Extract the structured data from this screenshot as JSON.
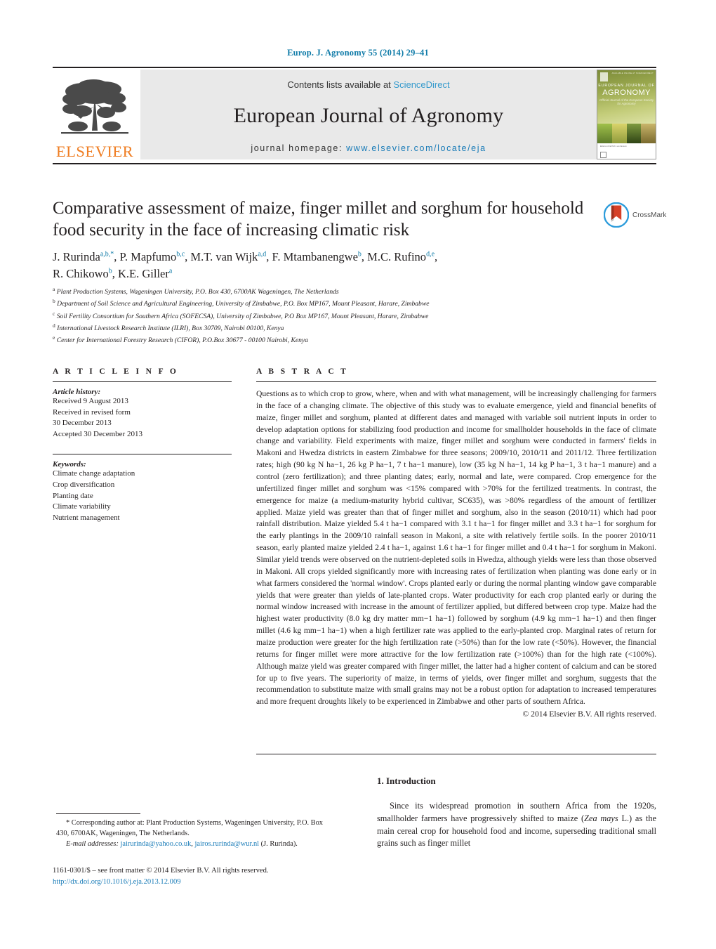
{
  "running_head": "Europ. J. Agronomy 55 (2014) 29–41",
  "masthead": {
    "contents_prefix": "Contents lists available at ",
    "sciencedirect": "ScienceDirect",
    "journal_title": "European Journal of Agronomy",
    "homepage_prefix": "journal homepage: ",
    "homepage_url": "www.elsevier.com/locate/eja",
    "publisher_logo_text": "ELSEVIER",
    "cover": {
      "top_note": "AVAILABLE ONLINE AT SCIENCEDIRECT",
      "line1": "EUROPEAN JOURNAL OF",
      "line2": "AGRONOMY",
      "line3": "Official Journal of the European Society for Agronomy",
      "bottom_note": "Editor-in-Chief\nM.K. van Ittersum"
    },
    "accent_link_color": "#3399cc",
    "url_color": "#1a7cb8",
    "elsevier_orange": "#ef7d22"
  },
  "article": {
    "title": "Comparative assessment of maize, finger millet and sorghum for household food security in the face of increasing climatic risk",
    "crossmark_label": "CrossMark",
    "authors_line1": "J. Rurinda",
    "authors": [
      {
        "name": "J. Rurinda",
        "marks": "a,b,*"
      },
      {
        "name": "P. Mapfumo",
        "marks": "b,c"
      },
      {
        "name": "M.T. van Wijk",
        "marks": "a,d"
      },
      {
        "name": "F. Mtambanengwe",
        "marks": "b"
      },
      {
        "name": "M.C. Rufino",
        "marks": "d,e"
      },
      {
        "name": "R. Chikowo",
        "marks": "b"
      },
      {
        "name": "K.E. Giller",
        "marks": "a"
      }
    ],
    "affiliations": [
      {
        "mark": "a",
        "text": "Plant Production Systems, Wageningen University, P.O. Box 430, 6700AK Wageningen, The Netherlands"
      },
      {
        "mark": "b",
        "text": "Department of Soil Science and Agricultural Engineering, University of Zimbabwe, P.O. Box MP167, Mount Pleasant, Harare, Zimbabwe"
      },
      {
        "mark": "c",
        "text": "Soil Fertility Consortium for Southern Africa (SOFECSA), University of Zimbabwe, P.O Box MP167, Mount Pleasant, Harare, Zimbabwe"
      },
      {
        "mark": "d",
        "text": "International Livestock Research Institute (ILRI), Box 30709, Nairobi 00100, Kenya"
      },
      {
        "mark": "e",
        "text": "Center for International Forestry Research (CIFOR), P.O.Box 30677 - 00100 Nairobi, Kenya"
      }
    ]
  },
  "article_info": {
    "heading": "A R T I C L E   I N F O",
    "history_label": "Article history:",
    "history": [
      "Received 9 August 2013",
      "Received in revised form",
      "30 December 2013",
      "Accepted 30 December 2013"
    ],
    "keywords_label": "Keywords:",
    "keywords": [
      "Climate change adaptation",
      "Crop diversification",
      "Planting date",
      "Climate variability",
      "Nutrient management"
    ]
  },
  "abstract": {
    "heading": "A B S T R A C T",
    "text": "Questions as to which crop to grow, where, when and with what management, will be increasingly challenging for farmers in the face of a changing climate. The objective of this study was to evaluate emergence, yield and financial benefits of maize, finger millet and sorghum, planted at different dates and managed with variable soil nutrient inputs in order to develop adaptation options for stabilizing food production and income for smallholder households in the face of climate change and variability. Field experiments with maize, finger millet and sorghum were conducted in farmers' fields in Makoni and Hwedza districts in eastern Zimbabwe for three seasons; 2009/10, 2010/11 and 2011/12. Three fertilization rates; high (90 kg N ha−1, 26 kg P ha−1, 7 t ha−1 manure), low (35 kg N ha−1, 14 kg P ha−1, 3 t ha−1 manure) and a control (zero fertilization); and three planting dates; early, normal and late, were compared. Crop emergence for the unfertilized finger millet and sorghum was <15% compared with >70% for the fertilized treatments. In contrast, the emergence for maize (a medium-maturity hybrid cultivar, SC635), was >80% regardless of the amount of fertilizer applied. Maize yield was greater than that of finger millet and sorghum, also in the season (2010/11) which had poor rainfall distribution. Maize yielded 5.4 t ha−1 compared with 3.1 t ha−1 for finger millet and 3.3 t ha−1 for sorghum for the early plantings in the 2009/10 rainfall season in Makoni, a site with relatively fertile soils. In the poorer 2010/11 season, early planted maize yielded 2.4 t ha−1, against 1.6 t ha−1 for finger millet and 0.4 t ha−1 for sorghum in Makoni. Similar yield trends were observed on the nutrient-depleted soils in Hwedza, although yields were less than those observed in Makoni. All crops yielded significantly more with increasing rates of fertilization when planting was done early or in what farmers considered the 'normal window'. Crops planted early or during the normal planting window gave comparable yields that were greater than yields of late-planted crops. Water productivity for each crop planted early or during the normal window increased with increase in the amount of fertilizer applied, but differed between crop type. Maize had the highest water productivity (8.0 kg dry matter mm−1 ha−1) followed by sorghum (4.9 kg mm−1 ha−1) and then finger millet (4.6 kg mm−1 ha−1) when a high fertilizer rate was applied to the early-planted crop. Marginal rates of return for maize production were greater for the high fertilization rate (>50%) than for the low rate (<50%). However, the financial returns for finger millet were more attractive for the low fertilization rate (>100%) than for the high rate (<100%). Although maize yield was greater compared with finger millet, the latter had a higher content of calcium and can be stored for up to five years. The superiority of maize, in terms of yields, over finger millet and sorghum, suggests that the recommendation to substitute maize with small grains may not be a robust option for adaptation to increased temperatures and more frequent droughts likely to be experienced in Zimbabwe and other parts of southern Africa.",
    "copyright": "© 2014 Elsevier B.V. All rights reserved."
  },
  "introduction": {
    "heading": "1. Introduction",
    "paragraph_part1": "Since its widespread promotion in southern Africa from the 1920s, smallholder farmers have progressively shifted to maize (",
    "species_italic": "Zea mays",
    "paragraph_part2": " L.) as the main cereal crop for household food and income, superseding traditional small grains such as finger millet"
  },
  "footnote": {
    "corresponding": "* Corresponding author at: Plant Production Systems, Wageningen University, P.O. Box 430, 6700AK, Wageningen, The Netherlands.",
    "email_label": "E-mail addresses:",
    "email1": "jairurinda@yahoo.co.uk",
    "email2": "jairos.rurinda@wur.nl",
    "email_suffix": "(J. Rurinda)."
  },
  "imprint": {
    "line1": "1161-0301/$ – see front matter © 2014 Elsevier B.V. All rights reserved.",
    "doi": "http://dx.doi.org/10.1016/j.eja.2013.12.009"
  }
}
